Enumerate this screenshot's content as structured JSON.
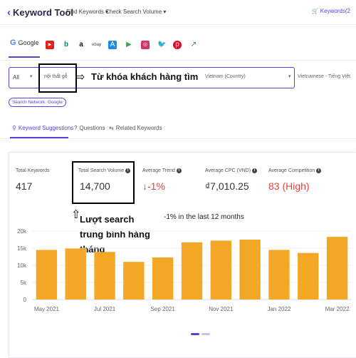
{
  "header": {
    "logo_text": "Keyword Tool",
    "nav_find": "Find Keywords",
    "nav_check": "Check Search Volume",
    "right_link": "Keywords(2"
  },
  "engines": {
    "active_label": "Google",
    "icons": [
      "youtube-icon",
      "bing-icon",
      "amazon-icon",
      "ebay-icon",
      "appstore-icon",
      "playstore-icon",
      "instagram-icon",
      "twitter-icon",
      "pinterest-icon",
      "trends-icon"
    ]
  },
  "search": {
    "scope": "All",
    "keyword": "nội thất gỗ",
    "country": "Vietnam (Country)",
    "language": "Vietnamese - Tiếng Việt",
    "network_button": "Search Network: Google"
  },
  "annotations": {
    "keyword_note": "Từ khóa khách hàng tìm",
    "volume_note": "Lượt search trung bình hàng tháng"
  },
  "result_tabs": [
    "Keyword Suggestions",
    "Questions",
    "Related Keywords"
  ],
  "metrics": {
    "total_keywords_label": "Total Keywords",
    "total_keywords_value": "417",
    "search_volume_label": "Total Search Volume",
    "search_volume_value": "14,700",
    "avg_trend_label": "Average Trend",
    "avg_trend_value": "-1%",
    "avg_cpc_label": "Average CPC (VND)",
    "avg_cpc_value": "₫7,010.25",
    "avg_comp_label": "Average Competition",
    "avg_comp_value": "83 (High)"
  },
  "trend_note": "-1% in the last 12 months",
  "colors": {
    "accent": "#5b3fd6",
    "bar": "#f2a727",
    "negative": "#e8433b"
  },
  "chart_data": {
    "type": "bar",
    "categories": [
      "May 2021",
      "Jun 2021",
      "Jul 2021",
      "Aug 2021",
      "Sep 2021",
      "Oct 2021",
      "Nov 2021",
      "Dec 2021",
      "Jan 2022",
      "Feb 2022",
      "Mar 2022"
    ],
    "tick_labels": [
      "May 2021",
      "Jul 2021",
      "Sep 2021",
      "Nov 2021",
      "Jan 2022",
      "Mar 2022"
    ],
    "values": [
      14500,
      14900,
      13900,
      11000,
      12300,
      16700,
      17200,
      17500,
      14500,
      13600,
      18300
    ],
    "y_ticks": [
      "0",
      "5k",
      "10k",
      "15k",
      "20k"
    ],
    "ylim": [
      0,
      20000
    ],
    "grid": true
  }
}
